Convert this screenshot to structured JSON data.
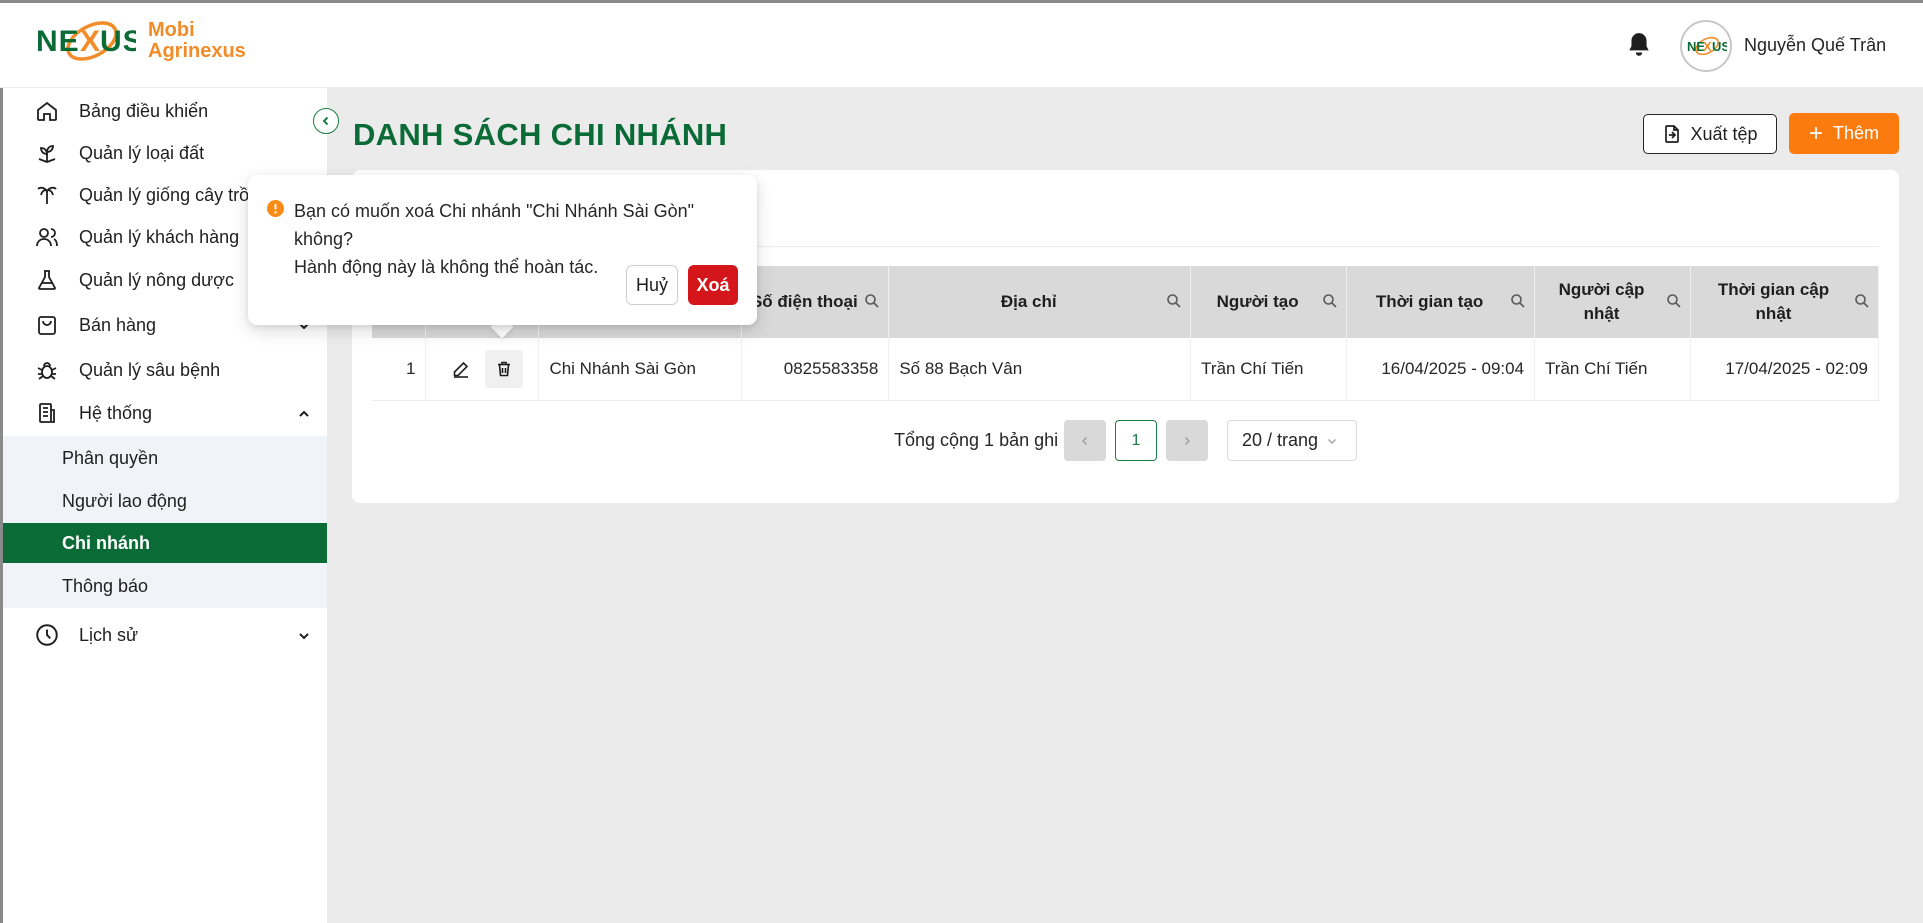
{
  "app": {
    "logo_text": "NEXUS",
    "brand_line1": "Mobi",
    "brand_line2": "Agrinexus"
  },
  "header": {
    "user_name": "Nguyễn Quế Trân",
    "avatar_text": "NEXUS"
  },
  "sidebar": {
    "items": [
      {
        "label": "Bảng điều khiển",
        "icon": "home-icon"
      },
      {
        "label": "Quản lý loại đất",
        "icon": "plant-icon"
      },
      {
        "label": "Quản lý giống cây trồng",
        "icon": "palm-tree-icon"
      },
      {
        "label": "Quản lý khách hàng",
        "icon": "users-icon"
      },
      {
        "label": "Quản lý nông dược",
        "icon": "flask-icon"
      },
      {
        "label": "Bán hàng",
        "icon": "shopping-bag-icon"
      },
      {
        "label": "Quản lý sâu bệnh",
        "icon": "bug-icon"
      },
      {
        "label": "Hệ thống",
        "icon": "building-icon"
      },
      {
        "label": "Lịch sử",
        "icon": "clock-icon"
      }
    ],
    "submenu": [
      {
        "label": "Phân quyền"
      },
      {
        "label": "Người lao động"
      },
      {
        "label": "Chi nhánh"
      },
      {
        "label": "Thông báo"
      }
    ],
    "active_submenu": "Chi nhánh"
  },
  "page": {
    "title": "DANH SÁCH CHI NHÁNH",
    "export_label": "Xuất tệp",
    "add_label": "Thêm"
  },
  "table": {
    "columns": [
      {
        "label": "Số điện thoại"
      },
      {
        "label": "Địa chỉ"
      },
      {
        "label": "Người tạo"
      },
      {
        "label": "Thời gian tạo"
      },
      {
        "label": "Người cập nhật"
      },
      {
        "label": "Thời gian cập nhật"
      }
    ],
    "rows": [
      {
        "index": "1",
        "name": "Chi Nhánh Sài Gòn",
        "phone": "0825583358",
        "address": "Số 88 Bạch Vân",
        "creator": "Trần Chí Tiến",
        "created_at": "16/04/2025 - 09:04",
        "updater": "Trần Chí Tiến",
        "updated_at": "17/04/2025 - 02:09"
      }
    ]
  },
  "pagination": {
    "total_text": "Tổng cộng 1 bản ghi",
    "current_page": "1",
    "page_size": "20 / trang"
  },
  "popconfirm": {
    "line1": "Bạn có muốn xoá Chi nhánh \"Chi Nhánh Sài Gòn\" không?",
    "line2": "Hành động này là không thể hoàn tác.",
    "cancel_label": "Huỷ",
    "ok_label": "Xoá"
  },
  "colors": {
    "primary_green": "#0b6b36",
    "accent_orange": "#fb7b0e",
    "danger_red": "#d4161b",
    "warning_orange": "#fa8c16"
  }
}
